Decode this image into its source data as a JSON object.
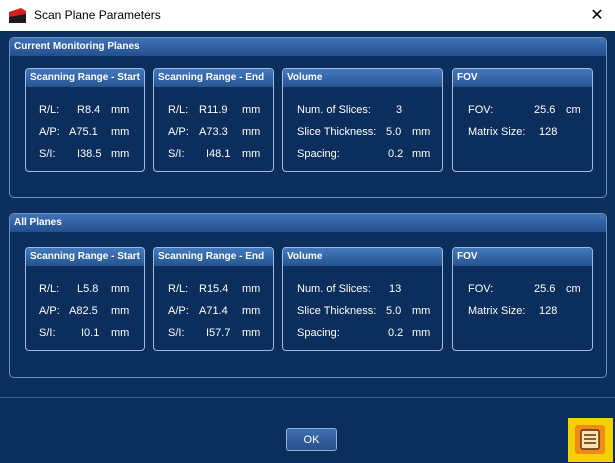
{
  "window": {
    "title": "Scan Plane Parameters",
    "close_glyph": "✕"
  },
  "groups": [
    {
      "title": "Current Monitoring Planes",
      "start": {
        "title": "Scanning Range - Start",
        "rl_label": "R/L:",
        "rl_value": "R8.4",
        "rl_unit": "mm",
        "ap_label": "A/P:",
        "ap_value": "A75.1",
        "ap_unit": "mm",
        "si_label": "S/I:",
        "si_value": "I38.5",
        "si_unit": "mm"
      },
      "end": {
        "title": "Scanning Range - End",
        "rl_label": "R/L:",
        "rl_value": "R11.9",
        "rl_unit": "mm",
        "ap_label": "A/P:",
        "ap_value": "A73.3",
        "ap_unit": "mm",
        "si_label": "S/I:",
        "si_value": "I48.1",
        "si_unit": "mm"
      },
      "volume": {
        "title": "Volume",
        "slices_label": "Num. of Slices:",
        "slices_value": "3",
        "thickness_label": "Slice Thickness:",
        "thickness_value": "5.0",
        "thickness_unit": "mm",
        "spacing_label": "Spacing:",
        "spacing_value": "0.2",
        "spacing_unit": "mm"
      },
      "fov": {
        "title": "FOV",
        "fov_label": "FOV:",
        "fov_value": "25.6",
        "fov_unit": "cm",
        "matrix_label": "Matrix Size:",
        "matrix_value": "128"
      }
    },
    {
      "title": "All Planes",
      "start": {
        "title": "Scanning Range - Start",
        "rl_label": "R/L:",
        "rl_value": "L5.8",
        "rl_unit": "mm",
        "ap_label": "A/P:",
        "ap_value": "A82.5",
        "ap_unit": "mm",
        "si_label": "S/I:",
        "si_value": "I0.1",
        "si_unit": "mm"
      },
      "end": {
        "title": "Scanning Range - End",
        "rl_label": "R/L:",
        "rl_value": "R15.4",
        "rl_unit": "mm",
        "ap_label": "A/P:",
        "ap_value": "A71.4",
        "ap_unit": "mm",
        "si_label": "S/I:",
        "si_value": "I57.7",
        "si_unit": "mm"
      },
      "volume": {
        "title": "Volume",
        "slices_label": "Num. of Slices:",
        "slices_value": "13",
        "thickness_label": "Slice Thickness:",
        "thickness_value": "5.0",
        "thickness_unit": "mm",
        "spacing_label": "Spacing:",
        "spacing_value": "0.2",
        "spacing_unit": "mm"
      },
      "fov": {
        "title": "FOV",
        "fov_label": "FOV:",
        "fov_value": "25.6",
        "fov_unit": "cm",
        "matrix_label": "Matrix Size:",
        "matrix_value": "128"
      }
    }
  ],
  "footer": {
    "ok_label": "OK",
    "corner_button_icon": "document-list-icon"
  },
  "colors": {
    "background": "#0b2e5c",
    "header": "#3a6db0",
    "border": "#9fbbe0",
    "highlight": "#f4d000",
    "corner_button": "#f08a18"
  }
}
